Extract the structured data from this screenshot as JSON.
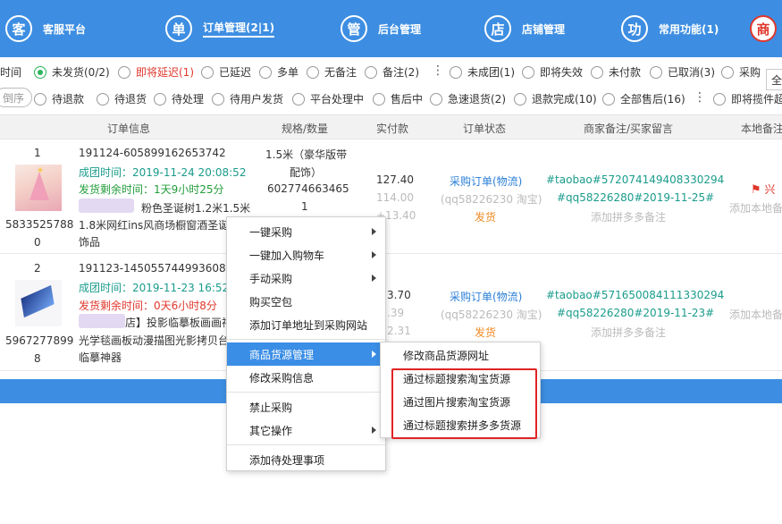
{
  "nav": {
    "items": [
      {
        "icon": "客",
        "label": "客服平台"
      },
      {
        "icon": "单",
        "label": "订单管理(2|1)"
      },
      {
        "icon": "管",
        "label": "后台管理"
      },
      {
        "icon": "店",
        "label": "店铺管理"
      },
      {
        "icon": "功",
        "label": "常用功能(1)"
      }
    ],
    "right_icon": "商",
    "right_label": "全"
  },
  "filters_row1": {
    "lead": "时间",
    "items": [
      "未发货(0/2)",
      "即将延迟(1)",
      "已延迟",
      "多单",
      "无备注",
      "备注(2)",
      "未成团(1)",
      "即将失效",
      "未付款",
      "已取消(3)",
      "采购"
    ]
  },
  "filters_row2": {
    "sort_label": "倒序",
    "items": [
      "待退款",
      "待退货",
      "待处理",
      "待用户发货",
      "平台处理中",
      "售后中",
      "急速退货(2)",
      "退款完成(10)",
      "全部售后(16)",
      "即将揽件超"
    ]
  },
  "table_header": [
    "订单信息",
    "规格/数量",
    "实付款",
    "订单状态",
    "商家备注/买家留言",
    "本地备注"
  ],
  "rows": [
    {
      "index": "1",
      "order_no": "191124-605899162653742",
      "group_time": "成团时间：2019-11-24 20:08:52",
      "ship_remaining": "发货剩余时间：1天9小时25分",
      "sku_short": "粉色圣诞树1.2米1.5米",
      "title_line1": "1.8米网红ins风商场橱窗酒圣诞",
      "title_line2": "饰品",
      "goods_id_a": "5833525788",
      "goods_id_b": "0",
      "spec_line1": "1.5米（豪华版带",
      "spec_line2": "配饰）",
      "spec_code": "602774663465",
      "qty": "1",
      "amount": "127.40",
      "amount_orig": "114.00",
      "amount_extra": "+13.40",
      "status_main": "采购订单(物流)",
      "status_sub": "(qq58226230 淘宝)",
      "status_action": "发货",
      "remark_line1": "#taobao#572074149408330294",
      "remark_line2": "#qq58226280#2019-11-25#",
      "remark_add": "添加拼多多备注",
      "local_flag_label": "兴",
      "local_add": "添加本地备"
    },
    {
      "index": "2",
      "order_no": "191123-145055744993608",
      "group_time": "成团时间：2019-11-23 16:52:",
      "ship_remaining": "发货剩余时间：0天6小时8分",
      "title_prefix": "店】投影临摹板画画神",
      "title_line1": "光学毯画板动漫描图光影拷贝台",
      "title_line2": "临摹神器",
      "goods_id_a": "5967277899",
      "goods_id_b": "8",
      "amount": "3.70",
      "amount_orig": ".39",
      "amount_extra": "2.31",
      "status_main": "采购订单(物流)",
      "status_sub": "(qq58226230 淘宝)",
      "status_action": "发货",
      "remark_line1": "#taobao#571650084111330294",
      "remark_line2": "#qq58226280#2019-11-23#",
      "remark_add": "添加拼多多备注",
      "local_add": "添加本地备"
    }
  ],
  "context_menu": {
    "items": [
      "一键采购",
      "一键加入购物车",
      "手动采购",
      "购买空包",
      "添加订单地址到采购网站",
      "商品货源管理",
      "修改采购信息",
      "禁止采购",
      "其它操作",
      "添加待处理事项"
    ],
    "highlighted": "商品货源管理"
  },
  "submenu": {
    "items": [
      "修改商品货源网址",
      "通过标题搜索淘宝货源",
      "通过图片搜索淘宝货源",
      "通过标题搜索拼多多货源"
    ]
  },
  "colors": {
    "nav_blue": "#3d8ee2",
    "highlight_blue": "#3a8ee6",
    "alert_red": "#e0372d",
    "teal": "#1a9c8c",
    "radio_green": "#2db55d"
  }
}
